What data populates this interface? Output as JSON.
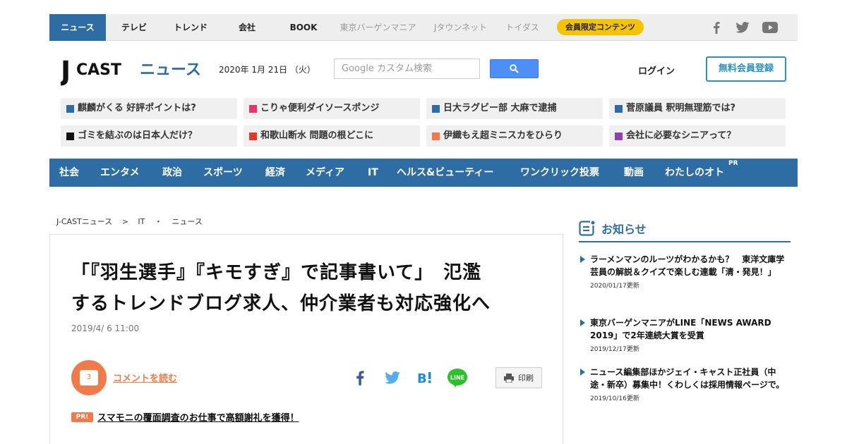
{
  "topnav": {
    "items": [
      "ニュース",
      "テレビ",
      "トレンド",
      "会社",
      "BOOK",
      "東京バーゲンマニア",
      "Jタウンネット",
      "トイダス"
    ],
    "member_label": "会員限定コンテンツ",
    "social": [
      "facebook-icon",
      "twitter-icon",
      "youtube-icon"
    ]
  },
  "header": {
    "logo_j": "J",
    "logo_cast": "CAST",
    "logo_news": "ニュース",
    "date": "2020年 1月 21日 （火）",
    "search_placeholder": "Google カスタム検索",
    "login": "ログイン",
    "register": "無料会員登録"
  },
  "trending": [
    {
      "text": "麒麟がくる 好評ポイントは?",
      "color": "#2e6da4"
    },
    {
      "text": "こりゃ便利ダイソースポンジ",
      "color": "#e8336d"
    },
    {
      "text": "日大ラグビー部 大麻で逮捕",
      "color": "#2e6da4"
    },
    {
      "text": "菅原議員 釈明無理筋では?",
      "color": "#2e6da4"
    },
    {
      "text": "ゴミを結ぶのは日本人だけ？",
      "color": "#111111"
    },
    {
      "text": "和歌山断水 問題の根どこに",
      "color": "#e23a2a"
    },
    {
      "text": "伊織もえ超ミニスカをひらり",
      "color": "#f07a4a"
    },
    {
      "text": "会社に必要なシニアって？",
      "color": "#8e44ad"
    }
  ],
  "categories": [
    "社会",
    "エンタメ",
    "政治",
    "スポーツ",
    "経済",
    "メディア",
    "IT",
    "ヘルス&ビューティー",
    "ワンクリック投票",
    "動画",
    "わたしのオト"
  ],
  "category_pr": "PR",
  "breadcrumb": [
    "J-CASTニュース",
    ">",
    "IT",
    "・",
    "ニュース"
  ],
  "article": {
    "headline_line1": "「『羽生選手』『キモすぎ』で記事書いて」　氾濫",
    "headline_line2": "するトレンドブログ求人、仲介業者も対応強化へ",
    "date": "2019/4/ 6 11:00",
    "comment_count": "3",
    "comment_link": "コメントを読む",
    "print_label": "印刷",
    "pr_badge": "PR!",
    "pr_link": "スマモニの覆面調査のお仕事で高額謝礼を獲得！"
  },
  "sidebar": {
    "title": "お知らせ",
    "notices": [
      {
        "text": "ラーメンマンのルーツがわかるかも？　東洋文庫学芸員の解説＆クイズで楽しむ連載「清・発見！」",
        "date": "2020/01/17更新"
      },
      {
        "text": "東京バーゲンマニアがLINE「NEWS AWARD 2019」で2年連続大賞を受賞",
        "date": "2019/12/17更新"
      },
      {
        "text": "ニュース編集部ほかジェイ・キャスト正社員（中途・新卒）募集中！くわしくは採用情報ページで。",
        "date": "2019/10/16更新"
      }
    ]
  },
  "colors": {
    "primary": "#2e6da4",
    "accent_orange": "#f07a4a",
    "member_yellow": "#f5c400"
  }
}
